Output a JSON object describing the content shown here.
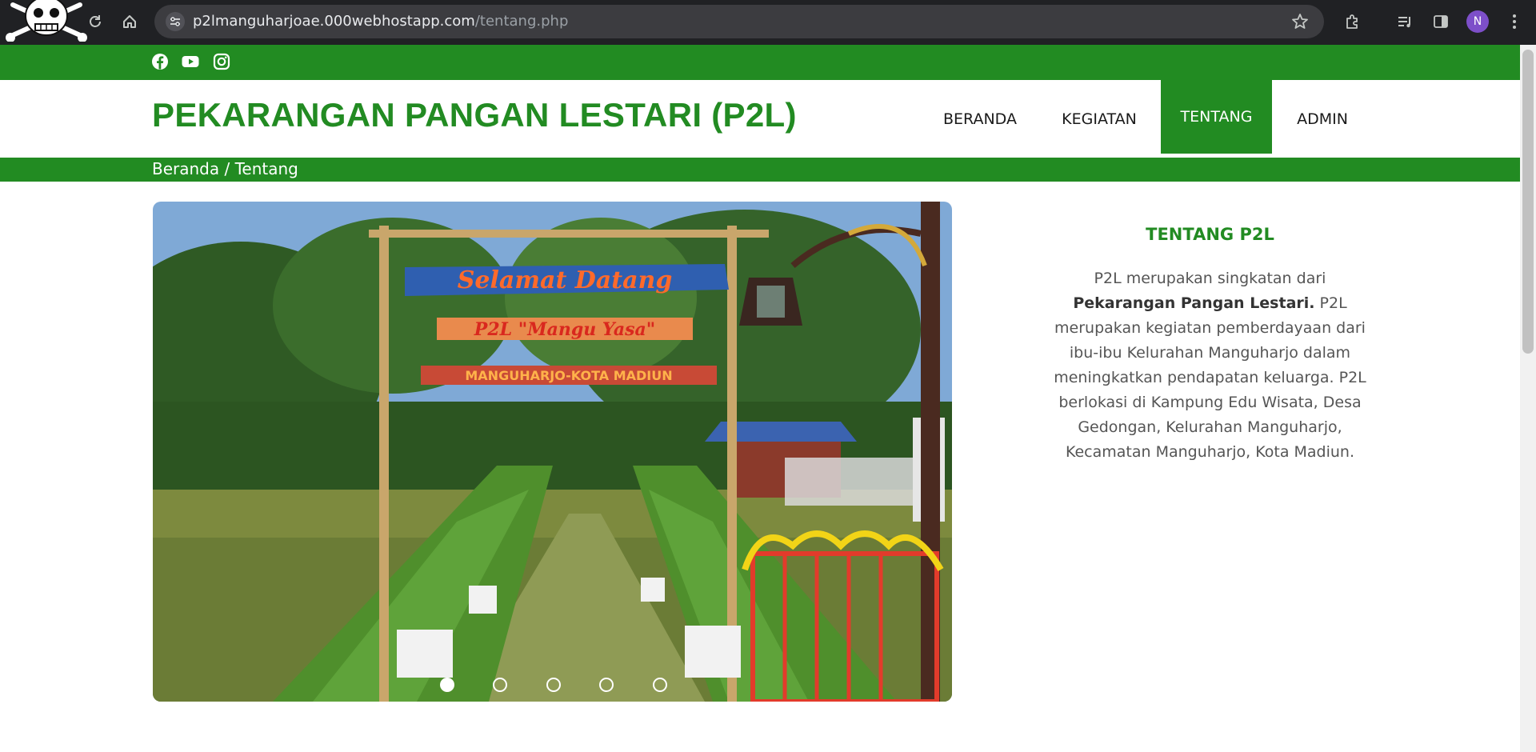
{
  "browser": {
    "url_host": "p2lmanguharjoae.000webhostapp.com",
    "url_path": "/tentang.php",
    "avatar_letter": "N"
  },
  "social": [
    "facebook-icon",
    "youtube-icon",
    "instagram-icon"
  ],
  "header": {
    "brand": "PEKARANGAN PANGAN LESTARI (P2L)",
    "nav": [
      "BERANDA",
      "KEGIATAN",
      "TENTANG",
      "ADMIN"
    ],
    "active_nav": "TENTANG"
  },
  "breadcrumb": "Beranda / Tentang",
  "carousel": {
    "sign_top": "Selamat Datang",
    "sign_mid": "P2L \"Mangu Yasa\"",
    "sign_bottom": "MANGUHARJO-KOTA MADIUN",
    "slide_count": 5,
    "active_slide": 1
  },
  "about": {
    "title": "TENTANG P2L",
    "text_before": "P2L merupakan singkatan dari ",
    "text_bold": "Pekarangan Pangan Lestari.",
    "text_after": " P2L merupakan kegiatan pemberdayaan dari ibu-ibu Kelurahan Manguharjo dalam meningkatkan pendapatan keluarga. P2L berlokasi di Kampung Edu Wisata, Desa Gedongan, Kelurahan Manguharjo, Kecamatan Manguharjo, Kota Madiun."
  },
  "colors": {
    "brand_green": "#228b22",
    "chrome_dark": "#202124",
    "omnibox": "#3c3c40"
  }
}
